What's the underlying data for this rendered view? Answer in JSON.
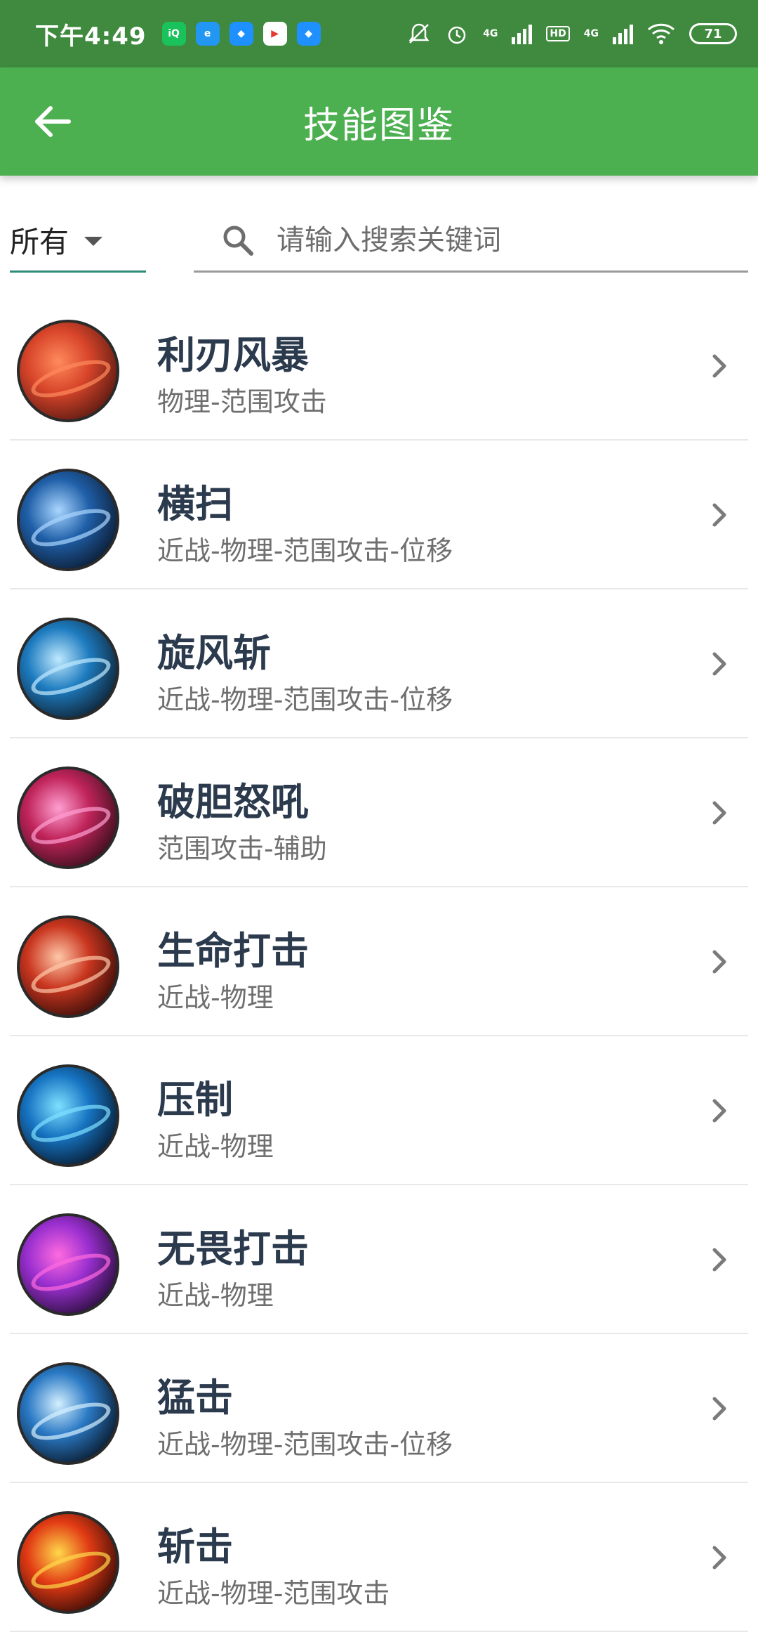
{
  "status": {
    "time": "下午4:49",
    "apps": [
      {
        "name": "iqiyi-icon",
        "glyph": "iQ",
        "color": "#19c25a"
      },
      {
        "name": "browser-icon",
        "glyph": "e",
        "color": "#2196f3"
      },
      {
        "name": "app-blue-icon",
        "glyph": "◆",
        "color": "#1e90ff"
      },
      {
        "name": "play-store-icon",
        "glyph": "▶",
        "color": "#ffffff"
      },
      {
        "name": "app-blue2-icon",
        "glyph": "◆",
        "color": "#1e90ff"
      }
    ],
    "network1": "4G",
    "hd": "HD",
    "network2": "4G",
    "battery": "71"
  },
  "appbar": {
    "title": "技能图鉴"
  },
  "filter": {
    "dropdown_value": "所有",
    "search_placeholder": "请输入搜索关键词"
  },
  "skills": [
    {
      "name": "利刃风暴",
      "tags": "物理-范围攻击",
      "colors": [
        "#5a1a12",
        "#d8452a",
        "#ff8a5c"
      ]
    },
    {
      "name": "横扫",
      "tags": "近战-物理-范围攻击-位移",
      "colors": [
        "#0c1c33",
        "#1f5fa8",
        "#a9d6ff"
      ]
    },
    {
      "name": "旋风斩",
      "tags": "近战-物理-范围攻击-位移",
      "colors": [
        "#0f2233",
        "#1d7bbf",
        "#bfe9ff"
      ]
    },
    {
      "name": "破胆怒吼",
      "tags": "范围攻击-辅助",
      "colors": [
        "#3b0f1e",
        "#c0245a",
        "#ff9ed1"
      ]
    },
    {
      "name": "生命打击",
      "tags": "近战-物理",
      "colors": [
        "#3a0e0a",
        "#c9361f",
        "#ffc7a8"
      ]
    },
    {
      "name": "压制",
      "tags": "近战-物理",
      "colors": [
        "#081c33",
        "#1674c2",
        "#7fe0ff"
      ]
    },
    {
      "name": "无畏打击",
      "tags": "近战-物理",
      "colors": [
        "#2a0f3d",
        "#9a2fd0",
        "#ff6adf"
      ]
    },
    {
      "name": "猛击",
      "tags": "近战-物理-范围攻击-位移",
      "colors": [
        "#0a1a2d",
        "#2a79c4",
        "#d4f0ff"
      ]
    },
    {
      "name": "斩击",
      "tags": "近战-物理-范围攻击",
      "colors": [
        "#3a0c06",
        "#e23b14",
        "#ffd84a"
      ]
    }
  ]
}
